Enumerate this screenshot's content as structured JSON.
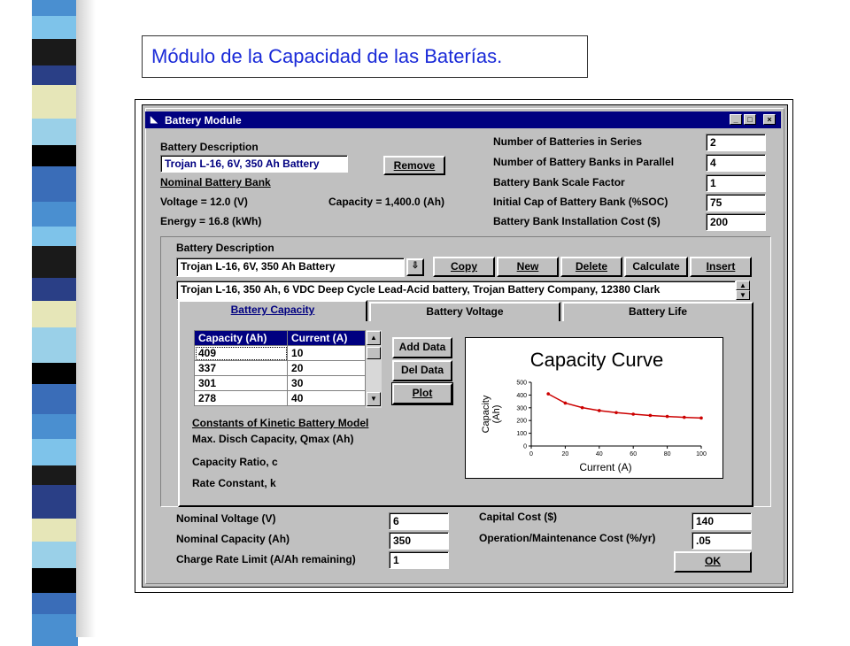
{
  "slide": {
    "title": "Módulo de la Capacidad de las Baterías."
  },
  "window": {
    "title": "Battery Module",
    "controls": [
      "_",
      "□",
      "×"
    ]
  },
  "top": {
    "battery_description_label": "Battery Description",
    "battery_description_value": "Trojan L-16, 6V, 350 Ah Battery",
    "remove_button": "Remove",
    "nominal_bank_label": "Nominal Battery Bank",
    "voltage": "Voltage = 12.0 (V)",
    "capacity": "Capacity = 1,400.0 (Ah)",
    "energy": "Energy = 16.8 (kWh)",
    "fields": [
      {
        "label": "Number of Batteries in Series",
        "value": "2"
      },
      {
        "label": "Number of Battery Banks in Parallel",
        "value": "4"
      },
      {
        "label": "Battery Bank Scale Factor",
        "value": "1"
      },
      {
        "label": "Initial Cap of Battery Bank (%SOC)",
        "value": "75"
      },
      {
        "label": "Battery Bank Installation Cost ($)",
        "value": "200"
      }
    ]
  },
  "library": {
    "label": "Battery Description",
    "selected": "Trojan L-16, 6V, 350 Ah Battery",
    "buttons": {
      "copy": "Copy",
      "new": "New",
      "delete": "Delete",
      "calculate": "Calculate",
      "insert": "Insert"
    },
    "description": "Trojan L-16, 350 Ah, 6 VDC Deep Cycle Lead-Acid battery, Trojan Battery Company, 12380 Clark"
  },
  "tabs": [
    "Battery Capacity",
    "Battery Voltage",
    "Battery Life"
  ],
  "capacity_table": {
    "headers": [
      "Capacity (Ah)",
      "Current (A)"
    ],
    "rows": [
      [
        "409",
        "10"
      ],
      [
        "337",
        "20"
      ],
      [
        "301",
        "30"
      ],
      [
        "278",
        "40"
      ]
    ]
  },
  "table_buttons": {
    "add": "Add Data",
    "del": "Del Data",
    "plot": "Plot"
  },
  "kinetic": {
    "title": "Constants of Kinetic Battery Model",
    "qmax": "Max. Disch Capacity, Qmax (Ah)",
    "ratio": "Capacity Ratio, c",
    "rate": "Rate Constant, k"
  },
  "chart_data": {
    "type": "line",
    "title": "Capacity Curve",
    "xlabel": "Current (A)",
    "ylabel": "Capacity\n(Ah)",
    "xlim": [
      0,
      100
    ],
    "ylim": [
      0,
      500
    ],
    "xticks": [
      "0",
      "20",
      "40",
      "60",
      "80",
      "100"
    ],
    "yticks": [
      "0",
      "100",
      "200",
      "300",
      "400",
      "500"
    ],
    "grid": false,
    "series": [
      {
        "x": [
          10,
          20,
          30,
          40,
          50,
          60,
          70,
          80,
          90,
          100
        ],
        "y": [
          409,
          337,
          301,
          278,
          262,
          250,
          240,
          232,
          225,
          220
        ]
      }
    ],
    "color": "#cc0000"
  },
  "bottom": {
    "nominal_voltage": {
      "label": "Nominal Voltage (V)",
      "value": "6"
    },
    "nominal_capacity": {
      "label": "Nominal Capacity (Ah)",
      "value": "350"
    },
    "charge_rate": {
      "label": "Charge Rate Limit (A/Ah remaining)",
      "value": "1"
    },
    "capital_cost": {
      "label": "Capital Cost ($)",
      "value": "140"
    },
    "om_cost": {
      "label": "Operation/Maintenance Cost (%/yr)",
      "value": ".05"
    },
    "ok_button": "OK"
  },
  "colors": {
    "title_text": "#1a2ad8",
    "titlebar": "#000080",
    "stripes": [
      "#4a8fd0",
      "#2a3f86",
      "#000000",
      "#7ec3ea",
      "#e6e6b8",
      "#3a6db8",
      "#1a1a1a",
      "#9ad0e8"
    ]
  }
}
